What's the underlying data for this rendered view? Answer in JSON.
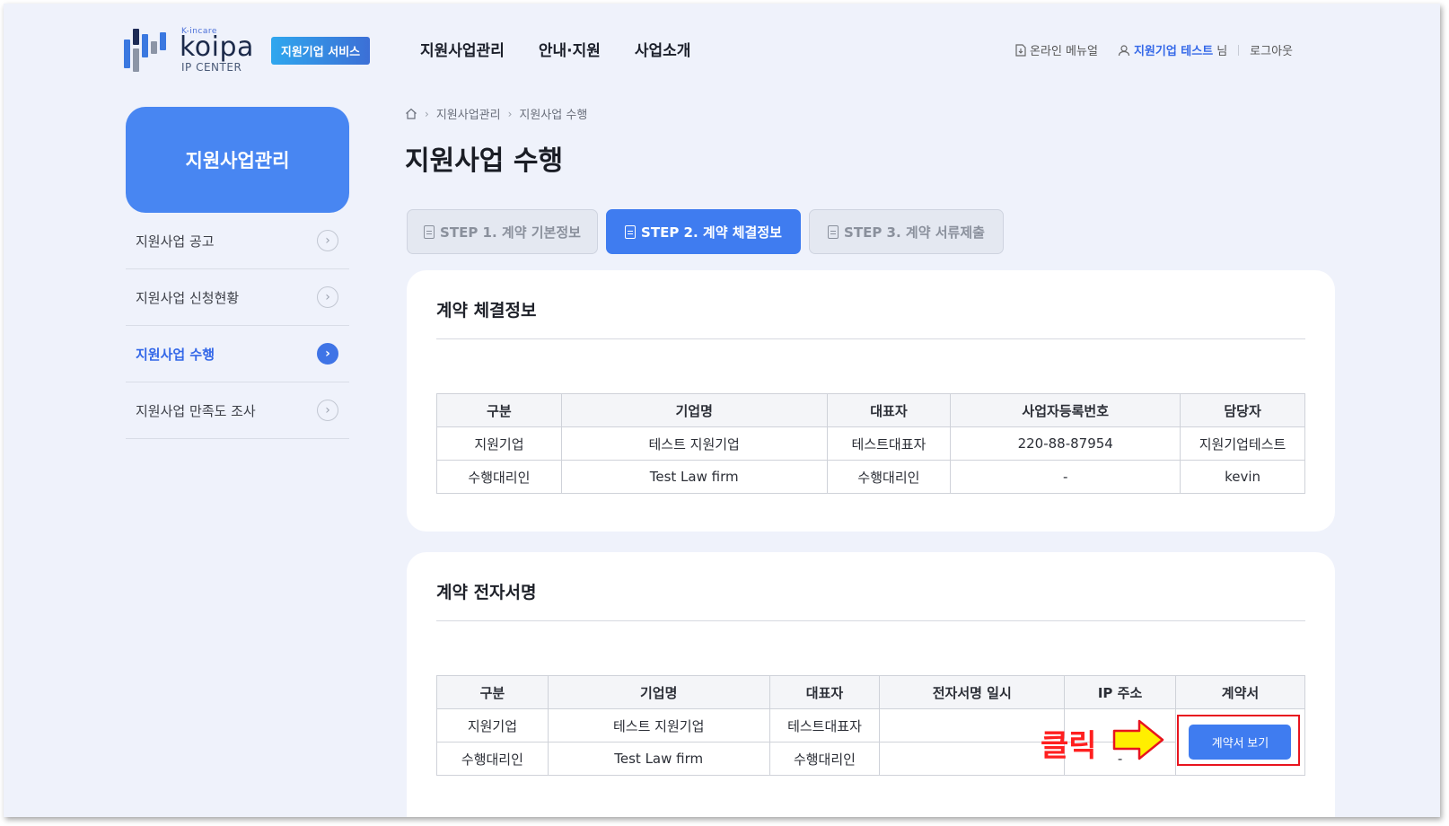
{
  "header": {
    "logo_small": "K-incare",
    "logo_word": "koipa",
    "logo_sub": "IP CENTER",
    "service_badge": "지원기업 서비스",
    "gnb": [
      "지원사업관리",
      "안내·지원",
      "사업소개"
    ],
    "util": {
      "manual": "온라인 메뉴얼",
      "user_name": "지원기업 테스트",
      "user_suffix": "님",
      "logout": "로그아웃"
    }
  },
  "sidebar": {
    "title": "지원사업관리",
    "items": [
      {
        "label": "지원사업 공고",
        "active": false
      },
      {
        "label": "지원사업 신청현황",
        "active": false
      },
      {
        "label": "지원사업 수행",
        "active": true
      },
      {
        "label": "지원사업 만족도 조사",
        "active": false
      }
    ]
  },
  "breadcrumb": [
    "지원사업관리",
    "지원사업 수행"
  ],
  "page_title": "지원사업 수행",
  "steps": [
    {
      "label": "STEP 1. 계약 기본정보",
      "active": false
    },
    {
      "label": "STEP 2. 계약 체결정보",
      "active": true
    },
    {
      "label": "STEP 3. 계약 서류제출",
      "active": false
    }
  ],
  "contract_info": {
    "title": "계약 체결정보",
    "headers": [
      "구분",
      "기업명",
      "대표자",
      "사업자등록번호",
      "담당자"
    ],
    "rows": [
      [
        "지원기업",
        "테스트 지원기업",
        "테스트대표자",
        "220-88-87954",
        "지원기업테스트"
      ],
      [
        "수행대리인",
        "Test Law firm",
        "수행대리인",
        "-",
        "kevin"
      ]
    ]
  },
  "signature": {
    "title": "계약 전자서명",
    "headers": [
      "구분",
      "기업명",
      "대표자",
      "전자서명 일시",
      "IP 주소",
      "계약서"
    ],
    "rows": [
      [
        "지원기업",
        "테스트 지원기업",
        "테스트대표자",
        "",
        "",
        ""
      ],
      [
        "수행대리인",
        "Test Law firm",
        "수행대리인",
        "",
        "-",
        ""
      ]
    ],
    "view_button": "계약서 보기"
  },
  "annotation": {
    "text": "클릭",
    "color": "#ff1f1f",
    "arrow_fill": "#ffef00",
    "arrow_stroke": "#e8141e"
  },
  "colors": {
    "accent": "#3f7cf0",
    "sidebar_title_bg": "#4886f2",
    "page_bg": "#eff2fb"
  }
}
